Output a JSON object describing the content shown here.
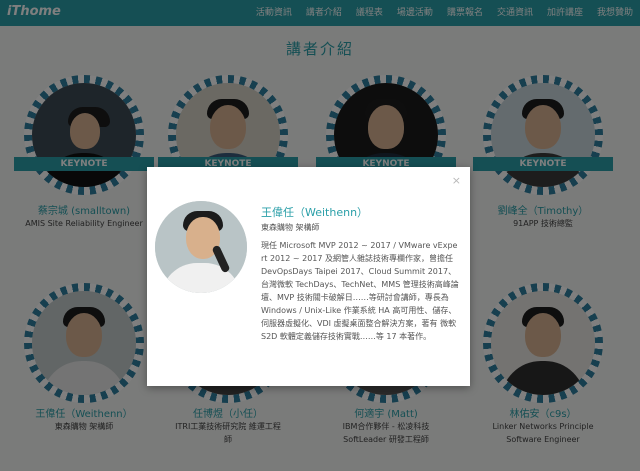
{
  "header": {
    "logo": "iThome",
    "nav": [
      "活動資訊",
      "講者介紹",
      "議程表",
      "場邊活動",
      "購票報名",
      "交通資訊",
      "加許講座",
      "我想贊助"
    ]
  },
  "page_title": "講者介紹",
  "speakers": [
    {
      "name": "蔡宗城 (smalltown)",
      "role": "AMIS Site Reliability Engineer",
      "badge": "KEYNOTE"
    },
    {
      "name": "",
      "role": "",
      "badge": "KEYNOTE"
    },
    {
      "name": "",
      "role": "",
      "badge": "KEYNOTE"
    },
    {
      "name": "劉峰全（Timothy）",
      "role": "91APP 技術總監",
      "badge": "KEYNOTE"
    },
    {
      "name": "王偉任（Weithenn）",
      "role": "東森購物 架構師"
    },
    {
      "name": "任博煜（小任）",
      "role": "ITRI工業技術研究院 維運工程師"
    },
    {
      "name": "何適宇 (Matt)",
      "role": "IBM合作夥伴 - 松凌科技 SoftLeader 研發工程師"
    },
    {
      "name": "林佑安（c9s）",
      "role": "Linker Networks Principle Software Engineer"
    }
  ],
  "modal": {
    "close_label": "×",
    "name": "王偉任（Weithenn）",
    "org": "東森購物 架構師",
    "bio": "現任 Microsoft MVP 2012 ~ 2017 / VMware vExpert 2012 ~ 2017 及網管人雜誌技術專欄作家，曾擔任 DevOpsDays Taipei 2017、Cloud Summit 2017、台灣微軟 TechDays、TechNet、MMS 管理技術高峰論壇、MVP 技術關卡破解日……等研討會講師，專長為 Windows / Unix-Like 作業系統 HA 高可用性、儲存、伺服器虛擬化、VDI 虛擬桌面整合解決方案，著有 微軟 S2D 軟體定義儲存技術實戰……等 17 本著作。"
  }
}
